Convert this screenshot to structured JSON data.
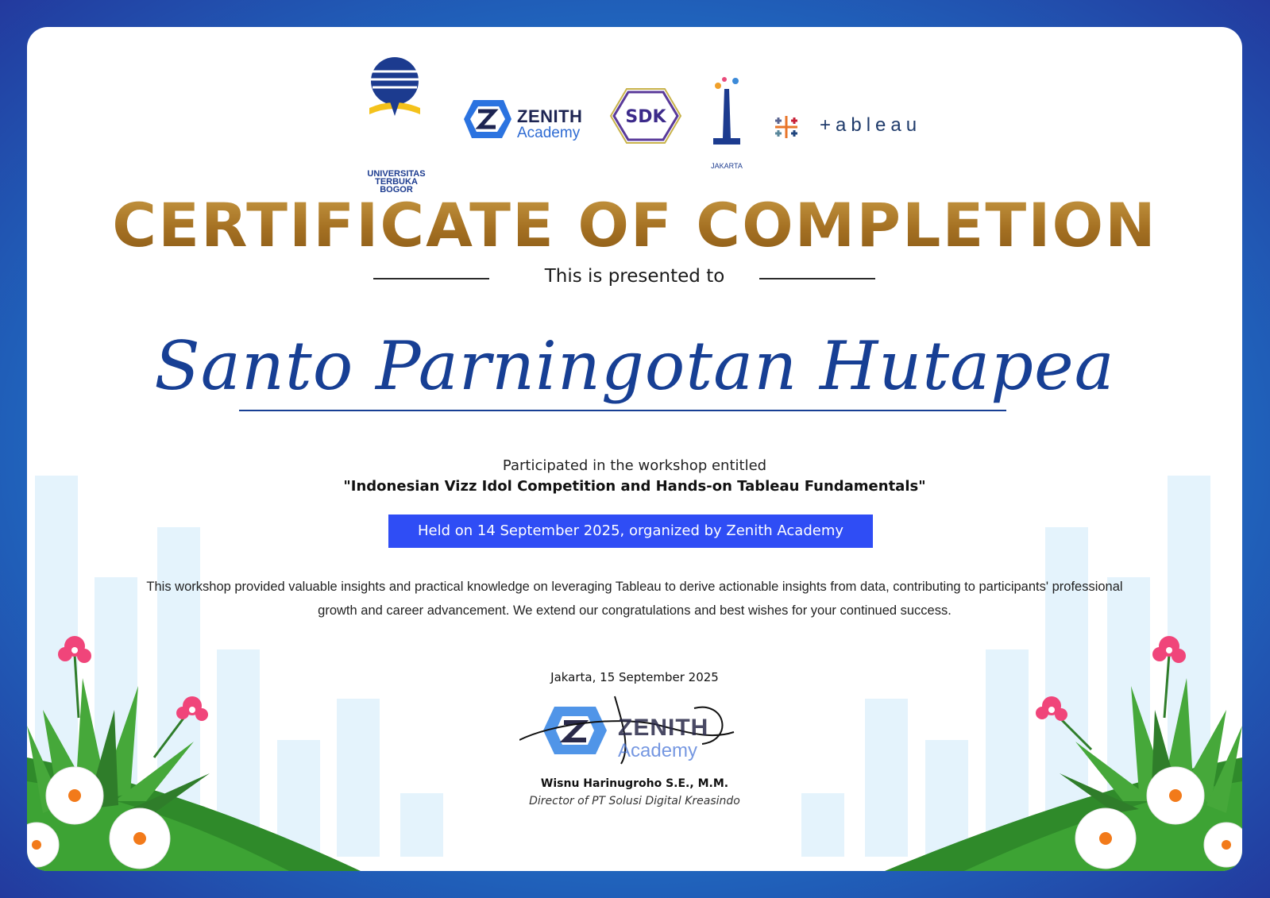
{
  "logos": {
    "ut_line1": "UNIVERSITAS TERBUKA",
    "ut_line2": "BOGOR",
    "zenith_name": "ZENITH",
    "zenith_sub": "Academy",
    "sdk_mark": "SDK",
    "jakarta": "JAKARTA",
    "tableau": "+ableau"
  },
  "certificate": {
    "title": "CERTIFICATE OF COMPLETION",
    "presented_to": "This is presented to",
    "recipient": "Santo Parningotan Hutapea",
    "participated": "Participated in the workshop entitled",
    "workshop": "\"Indonesian Vizz Idol Competition and Hands-on Tableau Fundamentals\"",
    "held": "Held on 14 September 2025, organized by Zenith Academy",
    "description": "This workshop provided valuable insights and practical knowledge on leveraging Tableau to derive actionable insights from data, contributing to participants' professional growth and career advancement. We extend our congratulations and best wishes for your continued success.",
    "place_date": "Jakarta, 15 September 2025",
    "signer": "Wisnu Harinugroho S.E., M.M.",
    "signer_role": "Director of PT Solusi Digital Kreasindo"
  },
  "stamp": {
    "name": "ZENITH",
    "sub": "Academy"
  },
  "colors": {
    "gold": "#a87a2a",
    "name_blue": "#173f94",
    "banner_blue": "#2f4df5",
    "frame_blue": "#1e7fd0"
  }
}
